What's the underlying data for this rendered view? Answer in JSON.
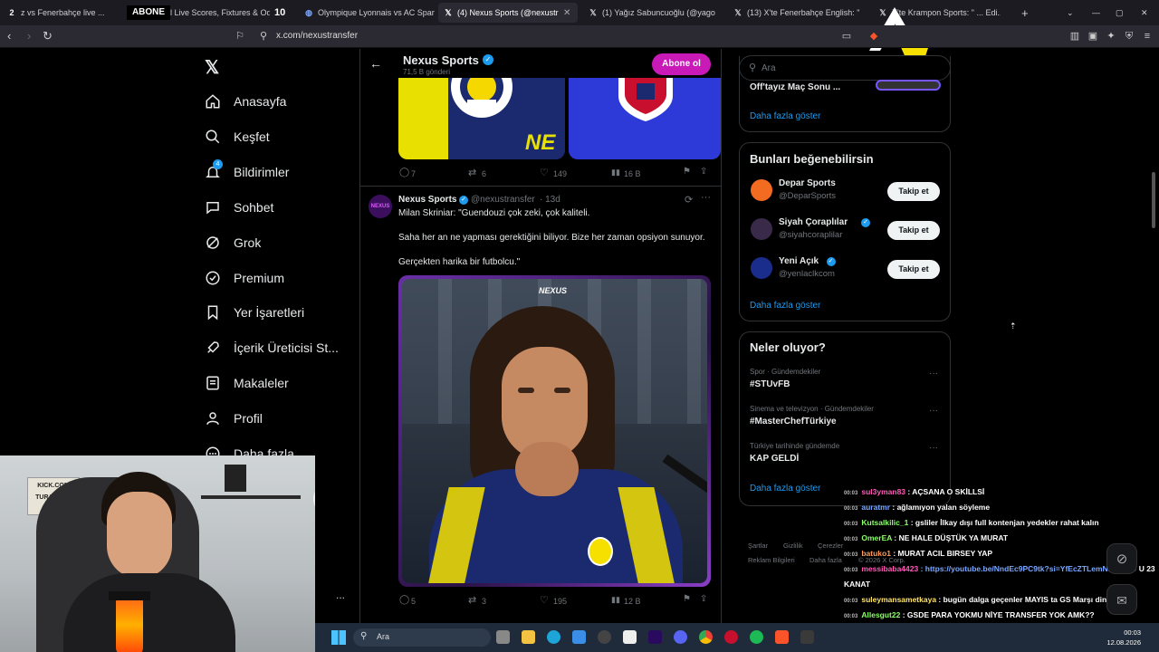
{
  "browser": {
    "tabs": [
      {
        "label": "z vs Fenerbahçe live ...",
        "prefix": "2"
      },
      {
        "label": "Football Live Scores, Fixtures & Od...",
        "badge": "10"
      },
      {
        "label": "Olympique Lyonnais vs AC Sparta P"
      },
      {
        "label": "(4) Nexus Sports (@nexustransf..."
      },
      {
        "label": "(1) Yağız Sabuncuoğlu (@yagosabu..."
      },
      {
        "label": "(13) X'te Fenerbahçe English: \"He al..."
      },
      {
        "label": "X'te Krampon Sports: \" ... Edi..."
      }
    ],
    "overlay_banner": "ABONE",
    "url": "x.com/nexustransfer"
  },
  "sidebar": {
    "items": [
      {
        "label": "Anasayfa",
        "icon": "home-icon"
      },
      {
        "label": "Keşfet",
        "icon": "search-icon"
      },
      {
        "label": "Bildirimler",
        "icon": "bell-icon",
        "badge": "4"
      },
      {
        "label": "Sohbet",
        "icon": "chat-icon"
      },
      {
        "label": "Grok",
        "icon": "grok-icon"
      },
      {
        "label": "Premium",
        "icon": "premium-icon"
      },
      {
        "label": "Yer İşaretleri",
        "icon": "bookmark-icon"
      },
      {
        "label": "İçerik Üreticisi St...",
        "icon": "rocket-icon"
      },
      {
        "label": "Makaleler",
        "icon": "article-icon"
      },
      {
        "label": "Profil",
        "icon": "profile-icon"
      },
      {
        "label": "Daha fazla",
        "icon": "more-icon"
      }
    ],
    "more_dots": "..."
  },
  "profile_header": {
    "name": "Nexus Sports",
    "subtitle": "71,5 B gönderi",
    "subscribe_label": "Abone ol"
  },
  "tweet1": {
    "stats": {
      "replies": "7",
      "retweets": "6",
      "likes": "149",
      "views": "16 B"
    }
  },
  "tweet2": {
    "author": "Nexus Sports",
    "handle": "@nexustransfer",
    "time": "· 13d",
    "line1": "Milan Skriniar: \"Guendouzi çok zeki, çok kaliteli.",
    "line2": "Saha her an ne yapması gerektiğini biliyor. Bize her zaman opsiyon sunuyor.",
    "line3": "Gerçekten harika bir futbolcu.\"",
    "image_watermark": "NEXUS",
    "stats": {
      "replies": "5",
      "retweets": "3",
      "likes": "195",
      "views": "12 B"
    }
  },
  "right": {
    "search_placeholder": "Ara",
    "top_item": "Off'tayız Maç Sonu ...",
    "show_more": "Daha fazla göster",
    "suggestions_title": "Bunları beğenebilirsin",
    "suggestions": [
      {
        "name": "Depar Sports",
        "handle": "@DeparSports",
        "verified": false,
        "color": "#f36a21",
        "follow": "Takip et"
      },
      {
        "name": "Siyah Çoraplılar",
        "handle": "@siyahcoraplilar",
        "verified": true,
        "color": "#3a2a4a",
        "follow": "Takip et"
      },
      {
        "name": "Yeni Açık",
        "handle": "@yenlaclkcom",
        "verified": true,
        "color": "#1a2c8c",
        "follow": "Takip et"
      }
    ],
    "trends_title": "Neler oluyor?",
    "trends": [
      {
        "meta": "Spor · Gündemdekiler",
        "name": "#STUvFB"
      },
      {
        "meta": "Sinema ve televizyon · Gündemdekiler",
        "name": "#MasterChefTürkiye"
      },
      {
        "meta": "Türkiye tarihinde gündemde",
        "name": "KAP GELDİ"
      }
    ],
    "footer": [
      "Şartlar",
      "Gizlilik",
      "Çerezler",
      "Reklam Bilgileri",
      "Daha fazla",
      "© 2026 X Corp."
    ]
  },
  "webcam": {
    "sign_lines": [
      "KICK.COM",
      "TURANCAN",
      "ON AIR"
    ]
  },
  "chat": [
    {
      "time": "00:03",
      "user": "sul3yman83",
      "color": "#ff5bb8",
      "msg": ": AÇSANA O SKİLLSİ"
    },
    {
      "time": "00:03",
      "user": "auratmr",
      "color": "#7aa7ff",
      "msg": ": ağlamıyon yalan söyleme"
    },
    {
      "time": "00:03",
      "user": "Kutsalkilic_1",
      "color": "#8cff6a",
      "msg": ": gsliler İlkay dışı full kontenjan yedekler rahat kalın"
    },
    {
      "time": "00:03",
      "user": "OmerEA",
      "color": "#8cff6a",
      "msg": ": NE HALE DÜŞTÜK YA MURAT"
    },
    {
      "time": "00:03",
      "user": "batuko1",
      "color": "#ff9f5b",
      "msg": ": MURAT ACIL BIRSEY YAP"
    },
    {
      "time": "00:03",
      "user": "messibaba4423",
      "color": "#ff5bb8",
      "msg": ": https://youtube.be/NndEc9PC9tk?si=YfEcZTLemNha2bSD",
      "extra": "U 23"
    },
    {
      "time": "",
      "user": "",
      "color": "#fff",
      "msg": "KANAT"
    },
    {
      "time": "00:03",
      "user": "suleymansametkaya",
      "color": "#ffe36a",
      "msg": ": bugün dalga geçenler MAYIS ta GS Marşı dinleyecek"
    },
    {
      "time": "00:03",
      "user": "Allesgut22",
      "color": "#8cff6a",
      "msg": ": GSDE PARA YOKMU NİYE TRANSFER YOK AMK??"
    },
    {
      "time": "00:03",
      "user": "yagiz_260",
      "color": "#8cff6a",
      "msg": ": VLAHOVICCC SIKILSSSSS"
    },
    {
      "time": "00:03",
      "user": "umut_1907z",
      "color": "#ff5bb8",
      "msg": ": guendouzi fener tarihin en iyisi olmaya doğru gidiyo"
    }
  ],
  "taskbar": {
    "search_label": "Ara",
    "clock": "00:03",
    "date": "12.08.2026"
  }
}
